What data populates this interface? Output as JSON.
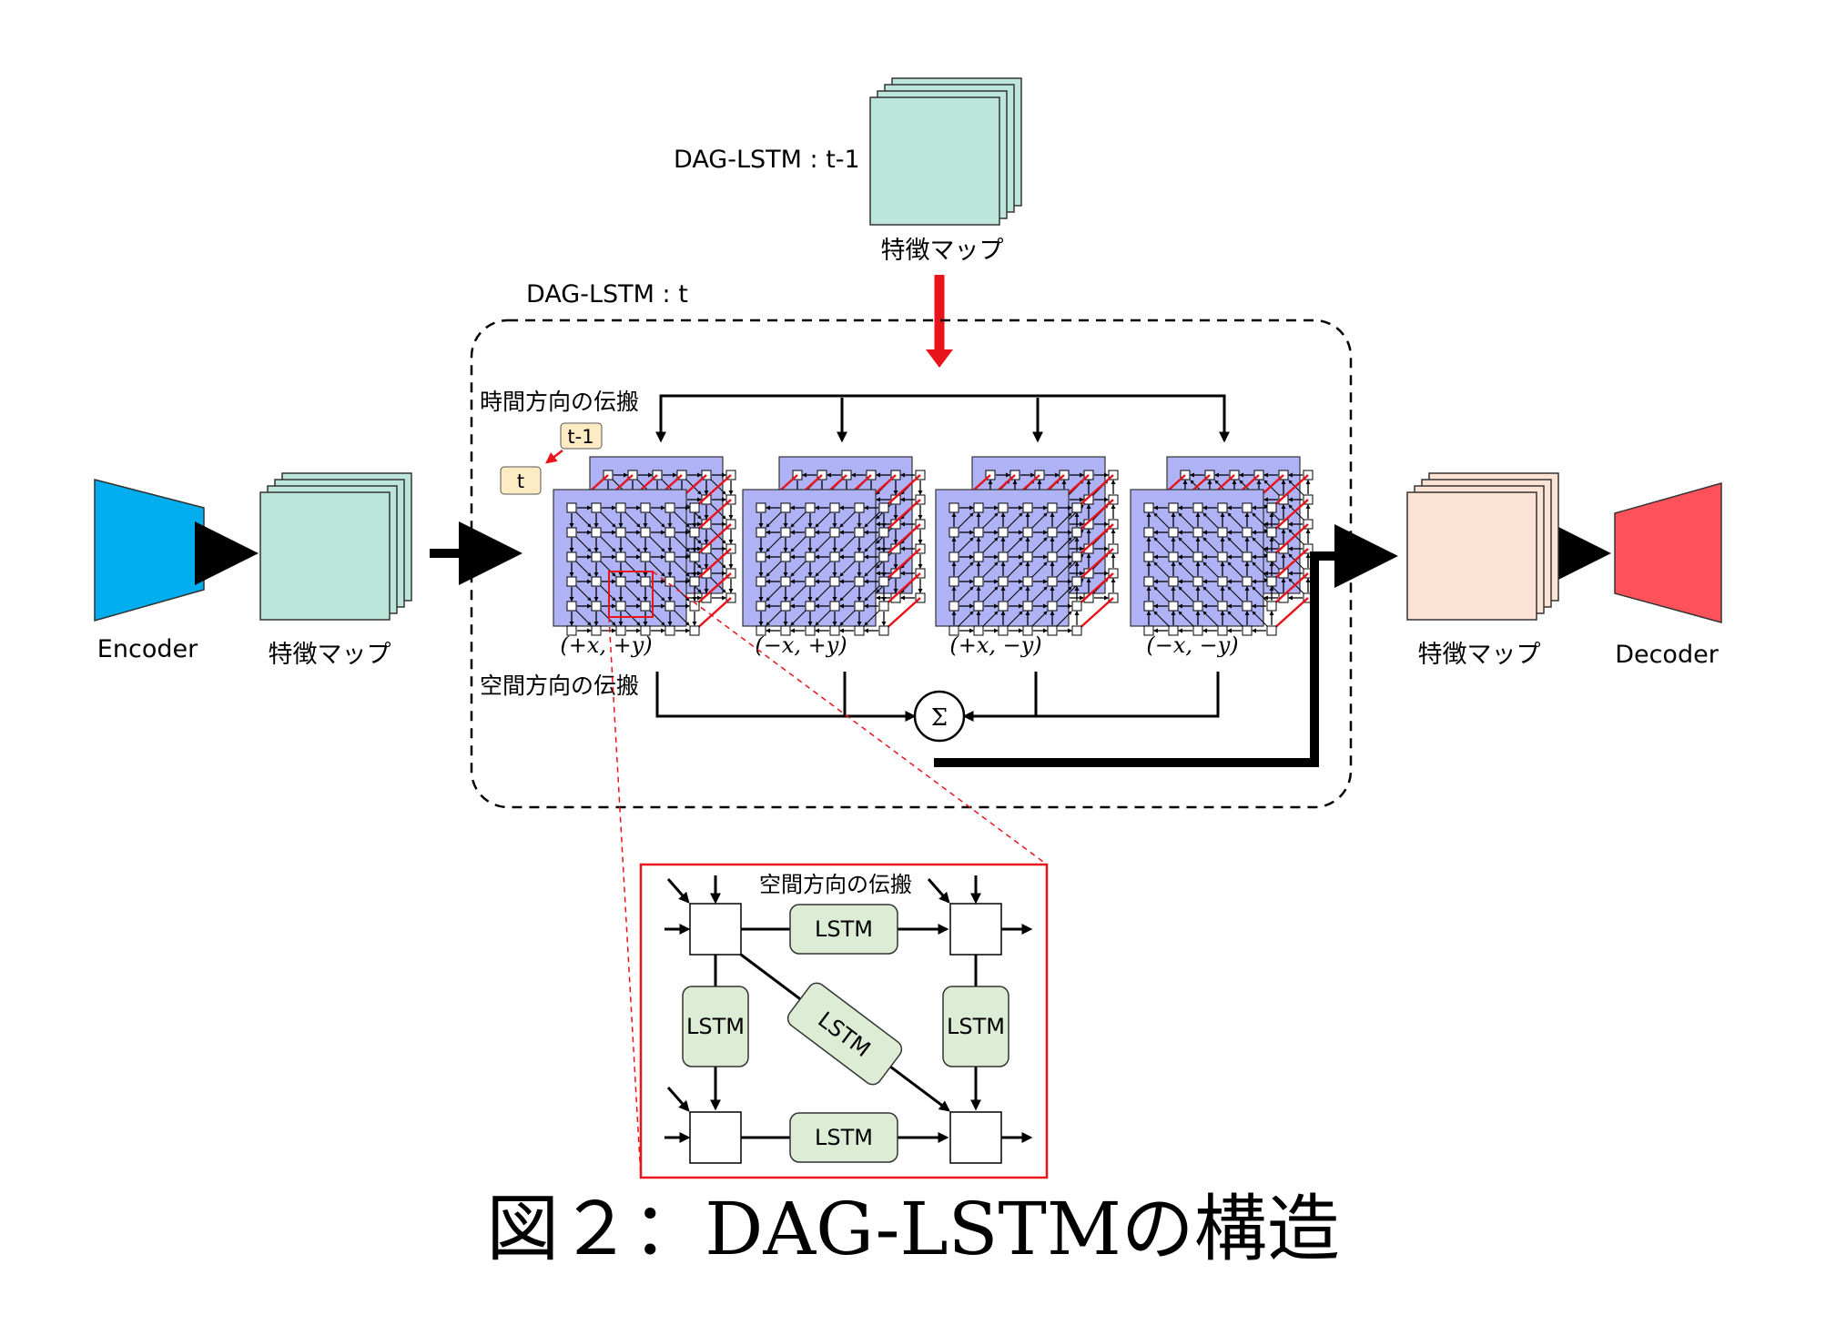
{
  "labels": {
    "encoder": "Encoder",
    "decoder": "Decoder",
    "feature_map_in": "特徴マップ",
    "feature_map_prev": "特徴マップ",
    "feature_map_out": "特徴マップ",
    "dag_lstm_prev": "DAG-LSTM : t-1",
    "dag_lstm_t": "DAG-LSTM : t",
    "temporal_propagation": "時間方向の伝搬",
    "spatial_propagation": "空間方向の伝搬",
    "sum_symbol": "Σ",
    "badge_t": "t",
    "badge_t_prev": "t-1",
    "directions": [
      "(+x, +y)",
      "(−x, +y)",
      "(+x, −y)",
      "(−x, −y)"
    ]
  },
  "detail": {
    "title": "空間方向の伝搬",
    "lstm_labels": [
      "LSTM",
      "LSTM",
      "LSTM",
      "LSTM",
      "LSTM"
    ]
  },
  "caption": "図２：DAG-LSTMの構造",
  "colors": {
    "encoder": "#00AEEF",
    "decoder": "#FF525B",
    "feature_map_green": "#BDE6DA",
    "feature_map_peach": "#FDE3D3",
    "grid_fill": "#AFB3F5",
    "lstm_fill": "#DDEDD5",
    "accent_red": "#E8141C",
    "badge_fill": "#FCEBC3"
  }
}
